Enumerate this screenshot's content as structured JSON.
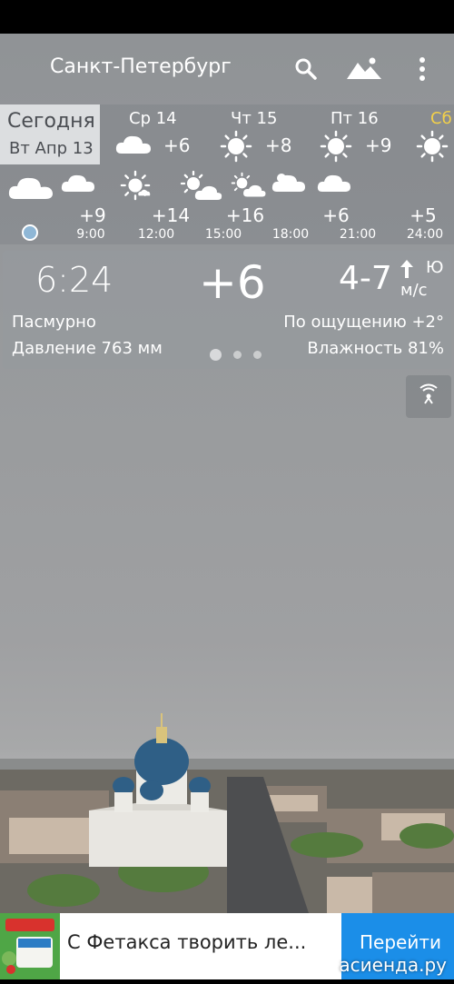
{
  "header": {
    "city": "Санкт-Петербург"
  },
  "today": {
    "title": "Сегодня",
    "date": "Вт Апр 13"
  },
  "days": [
    {
      "name": "Ср 14",
      "icon": "cloud-icon",
      "temp": "+6"
    },
    {
      "name": "Чт 15",
      "icon": "sun-icon",
      "temp": "+8"
    },
    {
      "name": "Пт 16",
      "icon": "sun-icon",
      "temp": "+9"
    },
    {
      "name": "Сб",
      "icon": "sun-icon",
      "temp": ""
    }
  ],
  "hourly": [
    {
      "icon": "cloud-icon",
      "temp": "",
      "time": ""
    },
    {
      "icon": "cloud-icon",
      "temp": "+9",
      "time": "9:00"
    },
    {
      "icon": "sun-icon",
      "temp": "+14",
      "time": "12:00"
    },
    {
      "icon": "partly-cloudy-icon",
      "temp": "+16",
      "time": "15:00"
    },
    {
      "icon": "partly-cloudy-icon",
      "temp": "",
      "time": "18:00"
    },
    {
      "icon": "cloud-icon",
      "temp": "+6",
      "time": "21:00"
    },
    {
      "icon": "cloud-icon",
      "temp": "+5",
      "time": "24:00"
    }
  ],
  "current": {
    "time": "6:24",
    "temp": "+6",
    "wind": "4-7",
    "wind_dir": "Ю",
    "wind_unit": "м/с",
    "condition": "Пасмурно",
    "feels_like": "По ощущению +2°",
    "pressure": "Давление 763 мм",
    "humidity": "Влажность 81%"
  },
  "ad": {
    "text": "С Фетакса творить ле...",
    "button": "Перейти"
  },
  "watermark": "асиенда.ру",
  "colors": {
    "saturday": "#f2d04a",
    "ad_button": "#1b8ee8",
    "ad_image": "#4fa646"
  }
}
